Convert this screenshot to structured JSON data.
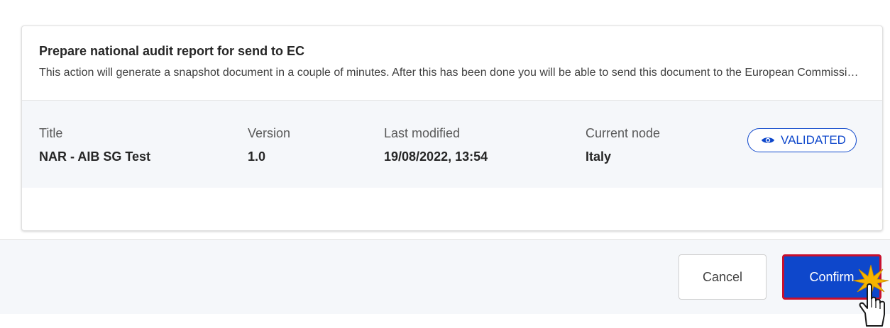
{
  "dialog": {
    "title": "Prepare national audit report for send to EC",
    "description": "This action will generate a snapshot document in a couple of minutes. After this has been done you will be able to send this document to the European Commission."
  },
  "info": {
    "title_label": "Title",
    "title_value": "NAR - AIB SG Test",
    "version_label": "Version",
    "version_value": "1.0",
    "modified_label": "Last modified",
    "modified_value": "19/08/2022, 13:54",
    "node_label": "Current node",
    "node_value": "Italy",
    "status": "VALIDATED",
    "status_icon": "eye-icon"
  },
  "footer": {
    "cancel_label": "Cancel",
    "confirm_label": "Confirm"
  },
  "colors": {
    "accent": "#0e47cb",
    "confirm_highlight": "#c8102e",
    "cursor_click_burst": "#f5b400"
  }
}
